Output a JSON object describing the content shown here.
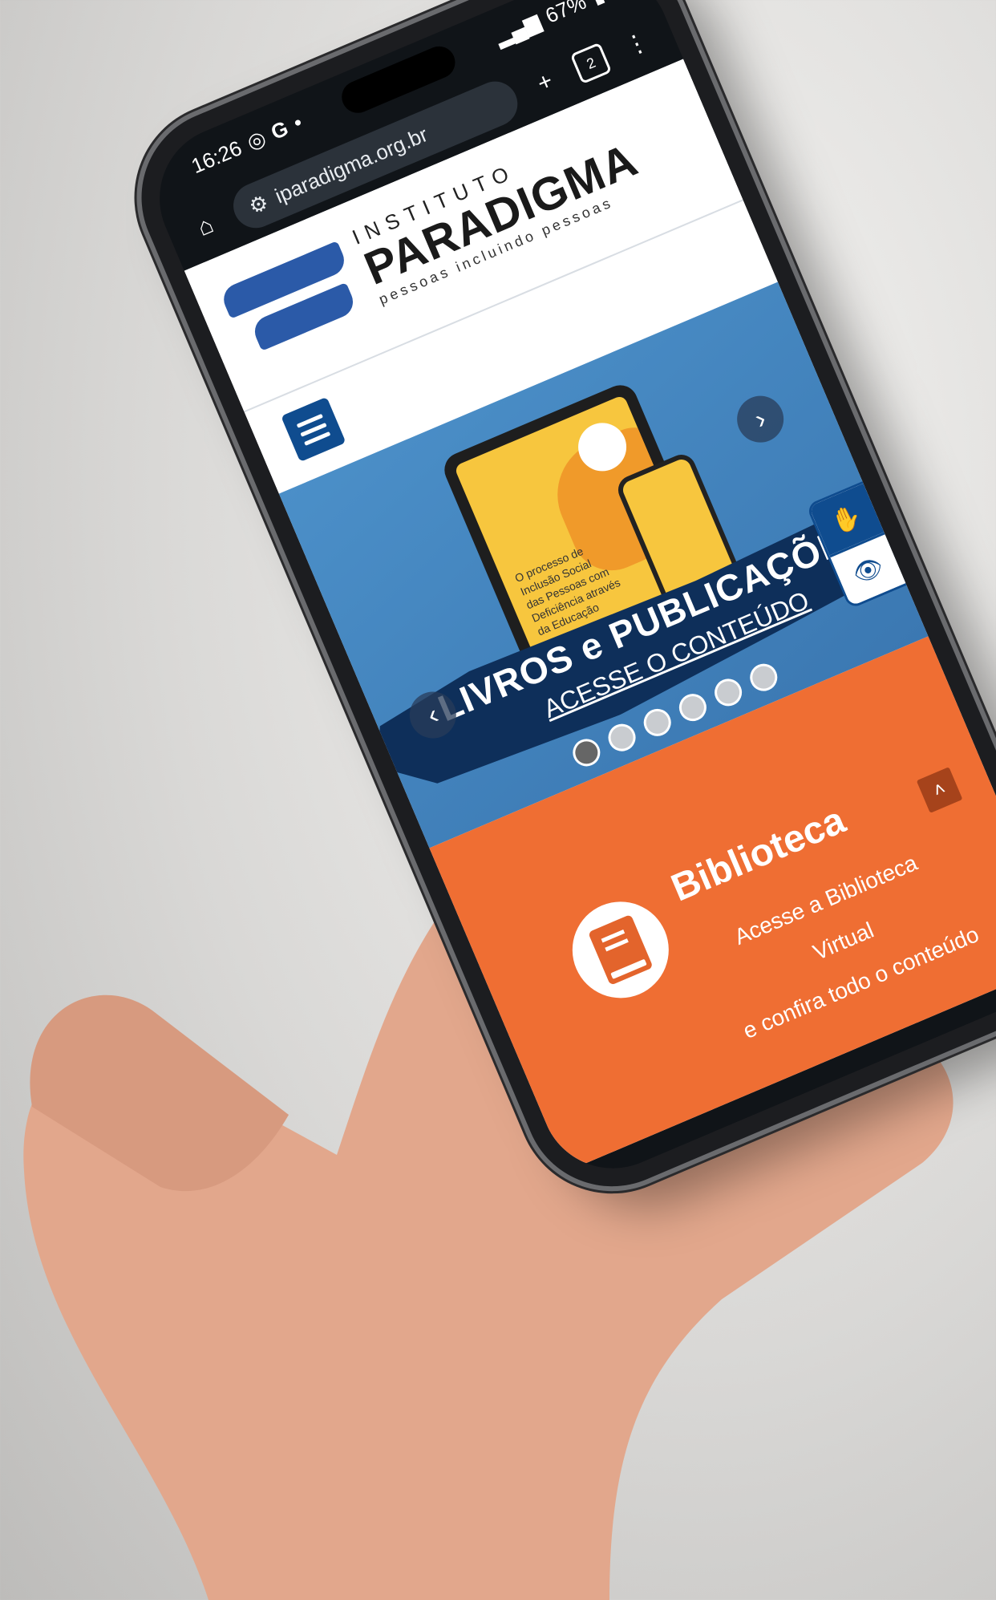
{
  "status_bar": {
    "time": "16:26",
    "battery": "67%"
  },
  "browser": {
    "url": "iparadigma.org.br",
    "tab_count": "2"
  },
  "logo": {
    "instituto": "INSTITUTO",
    "paradigma": "PARADIGMA",
    "tagline": "pessoas incluindo pessoas"
  },
  "hero": {
    "tablet_text": "O processo de Inclusão Social das Pessoas com Deficiência através da Educação",
    "title": "LIVROS e PUBLICAÇÕES",
    "link": "ACESSE O CONTEÚDO",
    "slide_count": 6,
    "active_slide": 0
  },
  "library": {
    "title": "Biblioteca",
    "text_line1": "Acesse a Biblioteca Virtual",
    "text_line2": "e confira todo o conteúdo"
  },
  "colors": {
    "brand_blue": "#0f4c8f",
    "orange": "#ef6e33",
    "banner_navy": "#0e2f5a"
  }
}
